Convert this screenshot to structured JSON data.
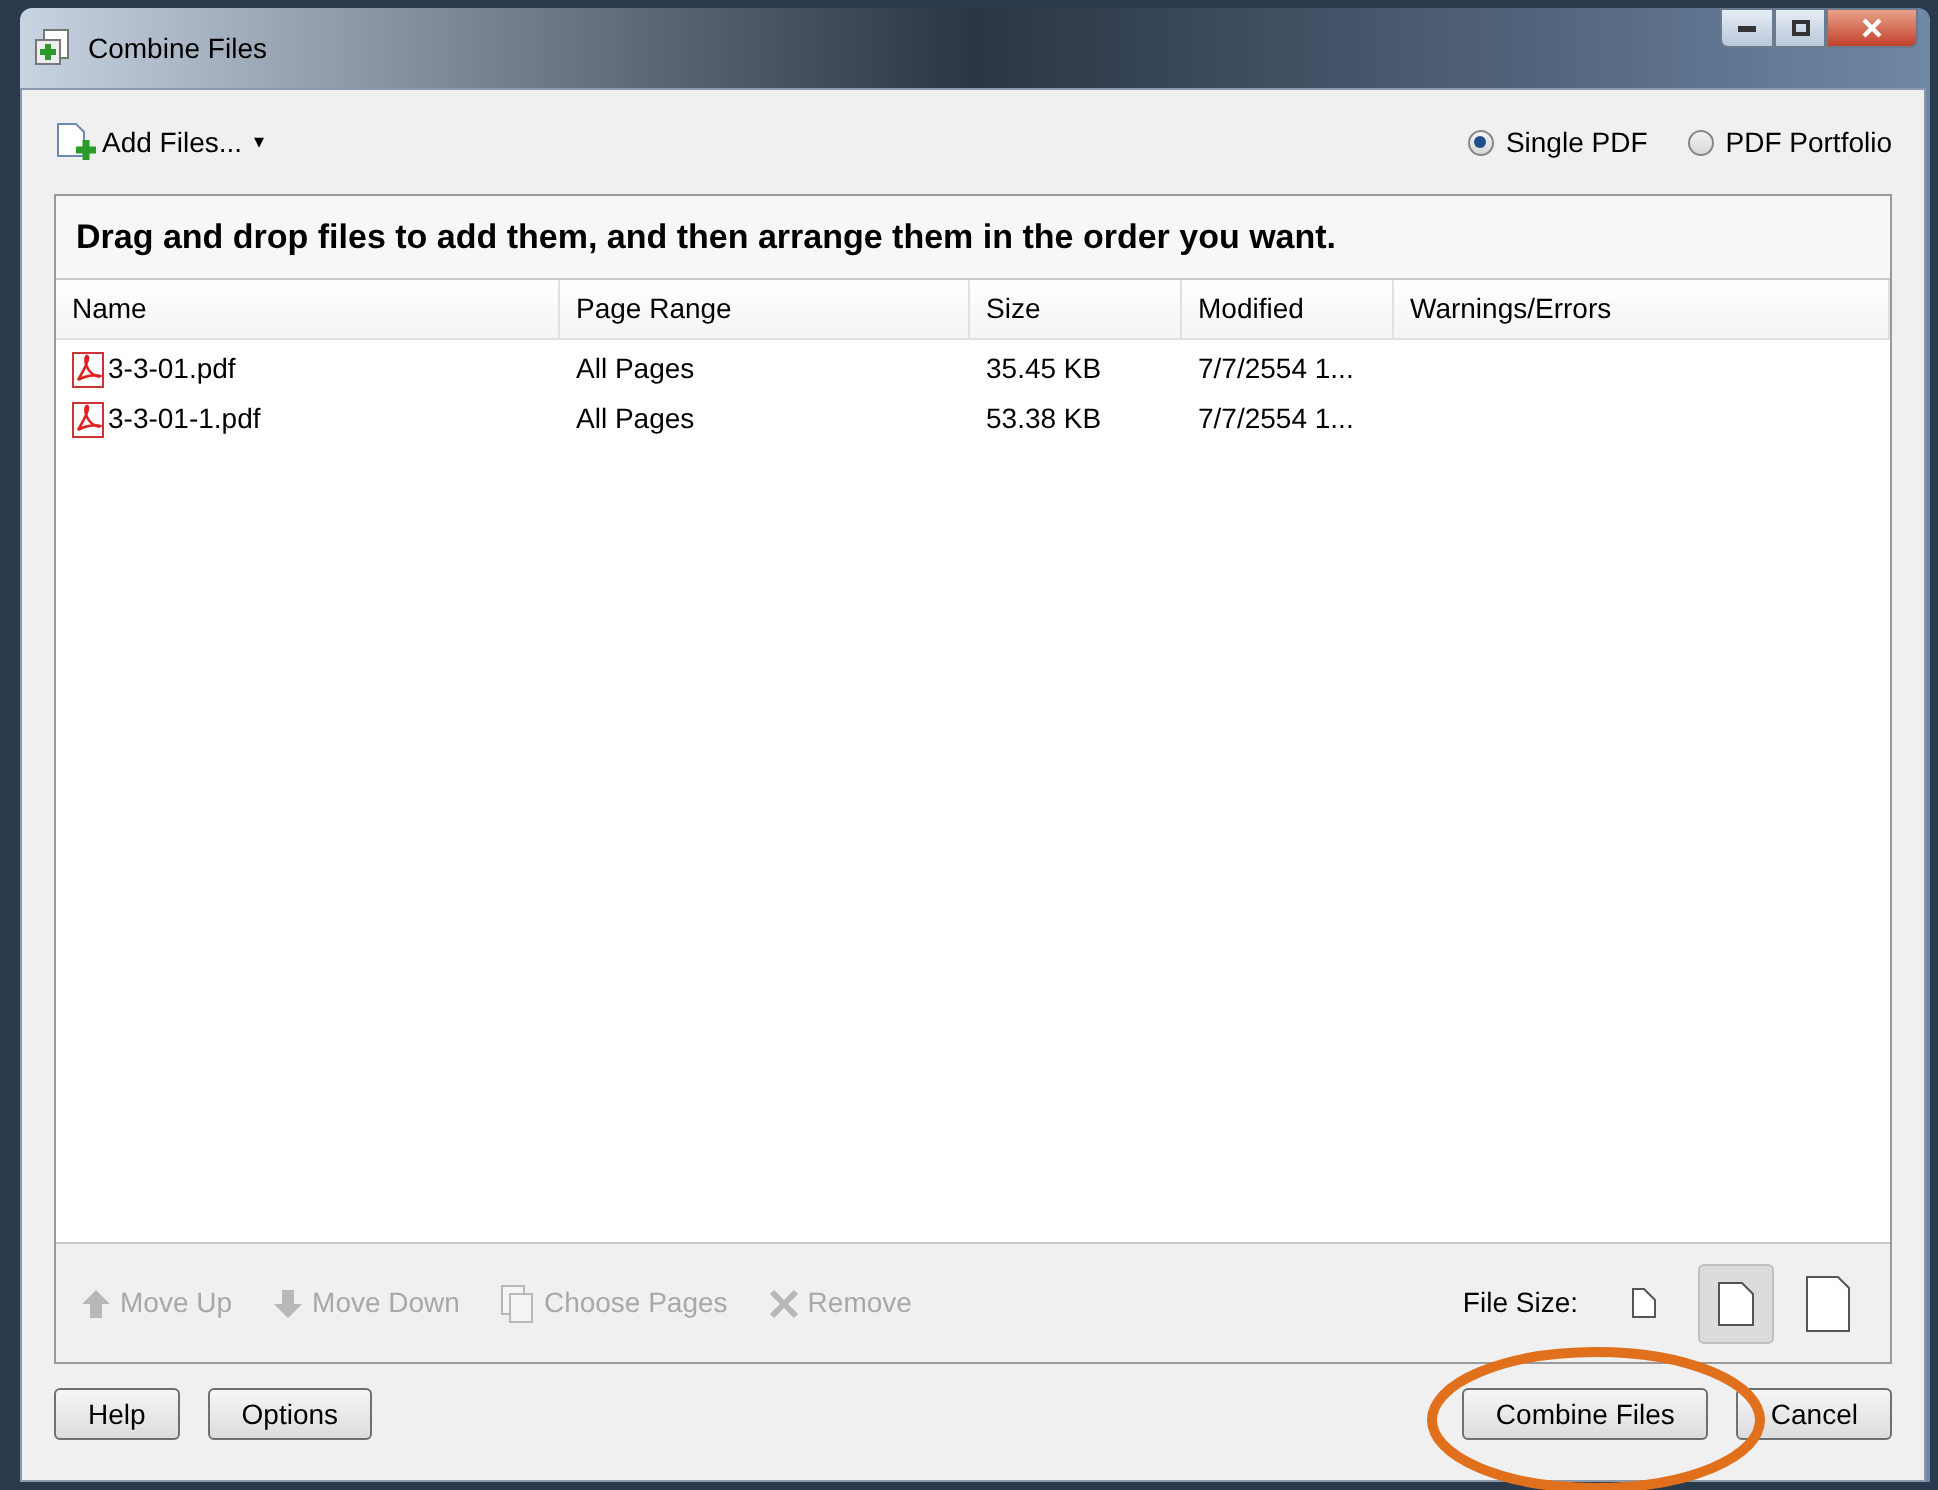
{
  "window": {
    "title": "Combine Files"
  },
  "toolbar": {
    "add_files": "Add Files...",
    "caret": "▾",
    "output_options": [
      {
        "label": "Single PDF",
        "selected": true
      },
      {
        "label": "PDF Portfolio",
        "selected": false
      }
    ]
  },
  "instruction": "Drag and drop files to add them, and then arrange them in the order you want.",
  "table": {
    "columns": [
      "Name",
      "Page Range",
      "Size",
      "Modified",
      "Warnings/Errors"
    ],
    "rows": [
      [
        "3-3-01.pdf",
        "All Pages",
        "35.45 KB",
        "7/7/2554 1...",
        ""
      ],
      [
        "3-3-01-1.pdf",
        "All Pages",
        "53.38 KB",
        "7/7/2554 1...",
        ""
      ]
    ]
  },
  "actions": [
    {
      "label": "Move Up",
      "kind": "up",
      "disabled": true
    },
    {
      "label": "Move Down",
      "kind": "down",
      "disabled": true
    },
    {
      "label": "Choose Pages",
      "kind": "pages",
      "disabled": true
    },
    {
      "label": "Remove",
      "kind": "remove",
      "disabled": true
    }
  ],
  "file_size": {
    "label": "File Size:",
    "options": [
      {
        "kind": "small",
        "selected": false
      },
      {
        "kind": "medium",
        "selected": true
      },
      {
        "kind": "large",
        "selected": false
      }
    ]
  },
  "buttons_left": [
    "Help",
    "Options"
  ],
  "buttons_right": [
    "Combine Files",
    "Cancel"
  ]
}
